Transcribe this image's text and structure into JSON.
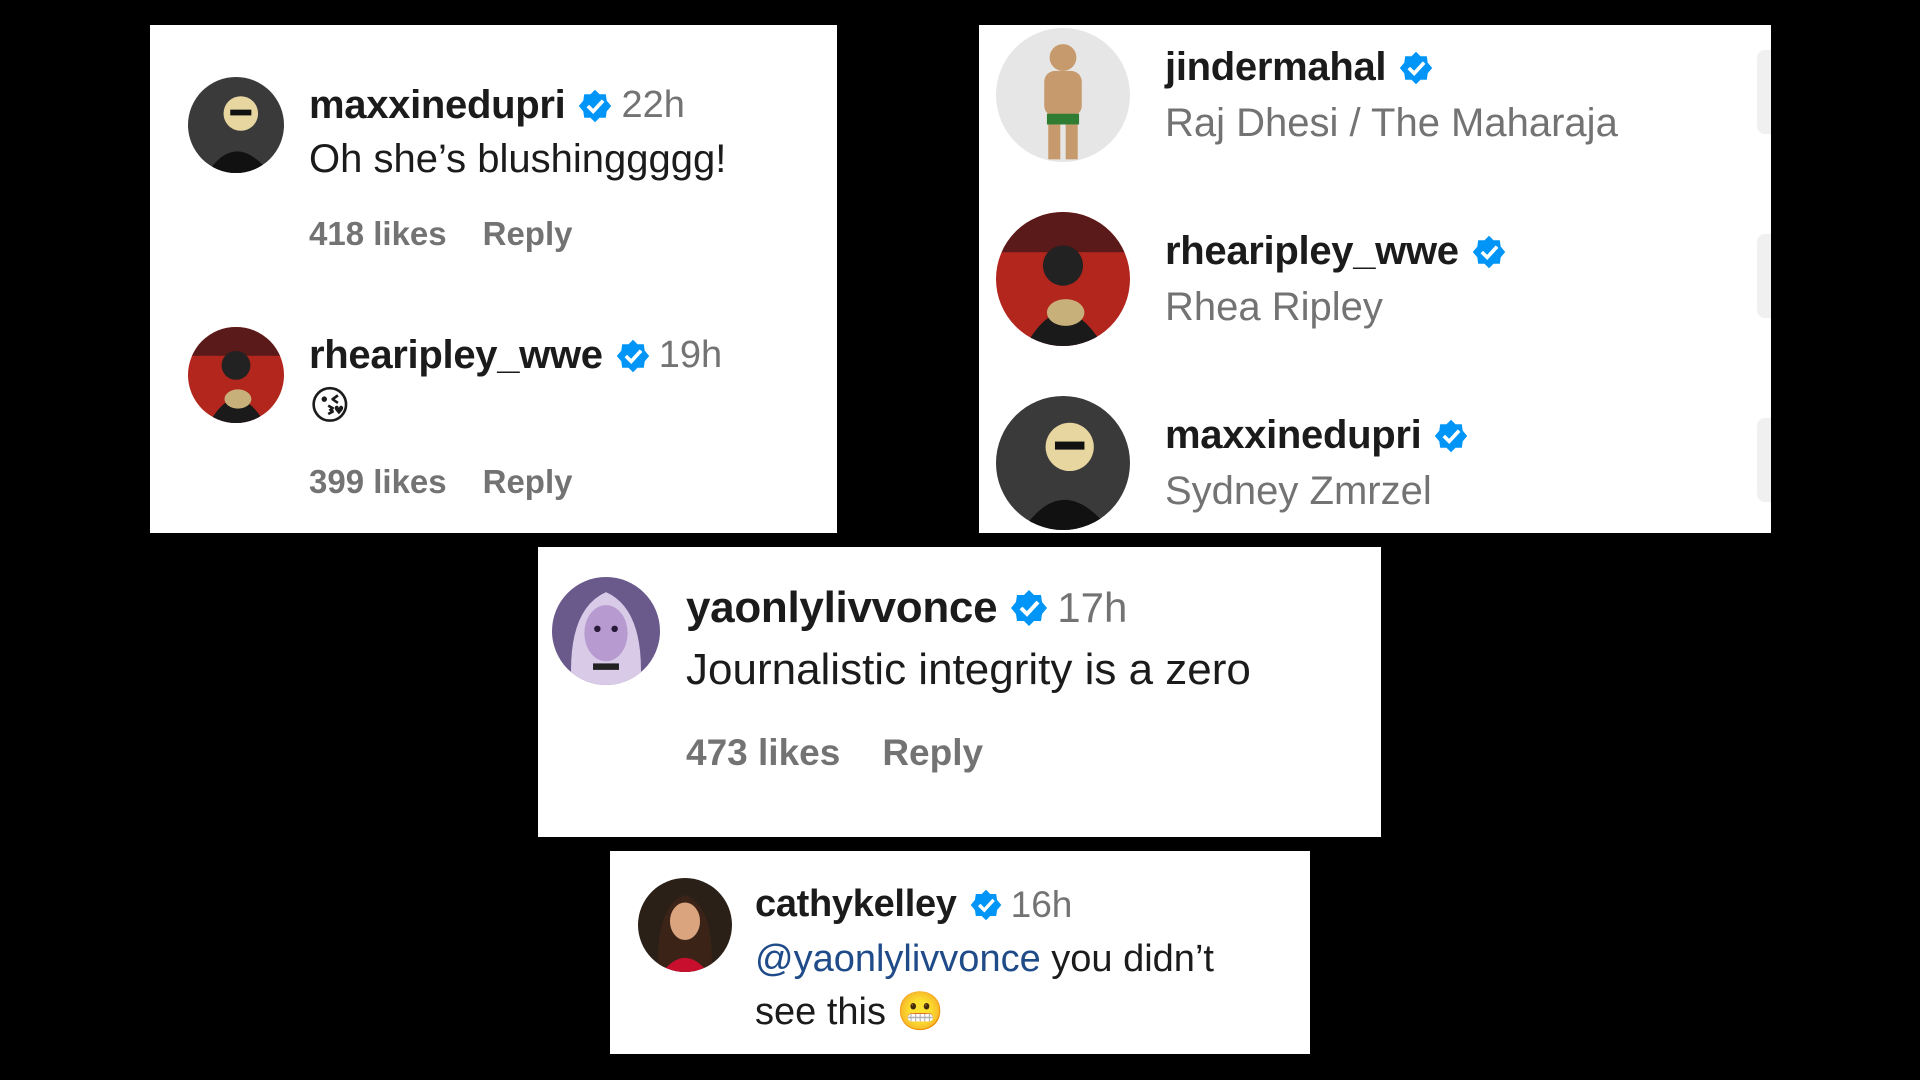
{
  "colors": {
    "background": "#000000",
    "card": "#ffffff",
    "username": "#1b1b1b",
    "muted": "#737373",
    "verified": "#0095f6",
    "mention": "#1f4b89"
  },
  "icons": {
    "verified": "verified-badge-icon",
    "avatar": "user-avatar"
  },
  "panel_a": {
    "comments": [
      {
        "username": "maxxinedupri",
        "time": "22h",
        "text": "Oh she’s blushinggggg!",
        "likes": "418 likes",
        "reply": "Reply"
      },
      {
        "username": "rhearipley_wwe",
        "time": "19h",
        "text": "😘",
        "likes": "399 likes",
        "reply": "Reply"
      }
    ]
  },
  "panel_b": {
    "users": [
      {
        "username": "jindermahal",
        "full_name": "Raj Dhesi / The Maharaja"
      },
      {
        "username": "rhearipley_wwe",
        "full_name": "Rhea Ripley"
      },
      {
        "username": "maxxinedupri",
        "full_name": "Sydney Zmrzel"
      }
    ]
  },
  "panel_c": {
    "comment": {
      "username": "yaonlylivvonce",
      "time": "17h",
      "text": "Journalistic integrity is a zero",
      "likes": "473 likes",
      "reply": "Reply"
    }
  },
  "panel_d": {
    "comment": {
      "username": "cathykelley",
      "time": "16h",
      "mention": "@yaonlylivvonce",
      "text_line1": " you didn’t",
      "text_line2": "see this ",
      "emoji": "😬"
    }
  }
}
